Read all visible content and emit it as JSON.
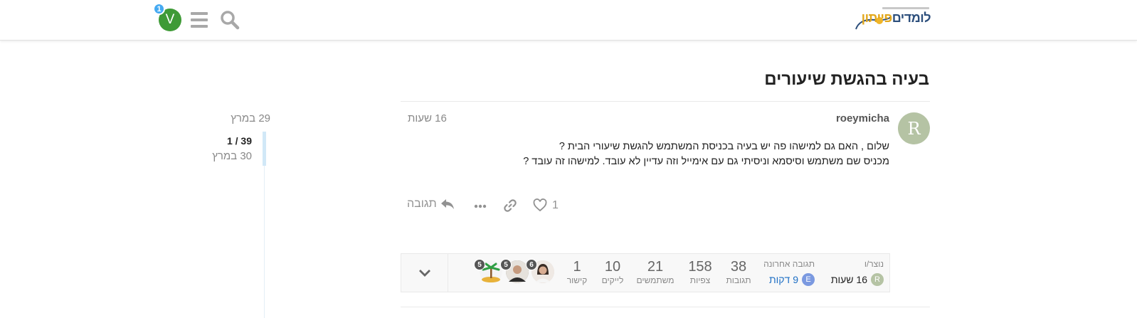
{
  "header": {
    "user_initial": "V",
    "notification_count": "1",
    "logo_text_part1": "לומדים",
    "logo_text_part2": "פייתון"
  },
  "topic": {
    "title": "בעיה בהגשת שיעורים"
  },
  "post": {
    "avatar_initial": "R",
    "username": "roeymicha",
    "time": "16 שעות",
    "body_line1": "שלום , האם גם למישהו פה יש בעיה בכניסת המשתמש להגשת שיעורי הבית ?",
    "body_line2": "מכניס שם משתמש וסיסמא וניסיתי גם עם אימייל וזה עדיין לא עובד. למישהו זה עובד ?",
    "like_count": "1",
    "reply_label": "תגובה"
  },
  "topic_map": {
    "created_label": "נוצר/ו",
    "created_avatar": "R",
    "created_value": "16 שעות",
    "last_reply_label": "תגובה אחרונה",
    "last_reply_avatar": "E",
    "last_reply_value": "9 דקות",
    "stats": [
      {
        "value": "38",
        "label": "תגובות"
      },
      {
        "value": "158",
        "label": "צפיות"
      },
      {
        "value": "21",
        "label": "משתמשים"
      },
      {
        "value": "10",
        "label": "לייקים"
      },
      {
        "value": "1",
        "label": "קישור"
      }
    ],
    "participants": [
      {
        "count": "6"
      },
      {
        "count": "5"
      },
      {
        "count": "5"
      }
    ]
  },
  "timeline": {
    "start_date": "29 במרץ",
    "position": "1 / 39",
    "current_date": "30 במרץ"
  },
  "colors": {
    "user_avatar": "#3e9a36",
    "notification": "#45aaf2",
    "link_blue": "#1e6fc5"
  }
}
